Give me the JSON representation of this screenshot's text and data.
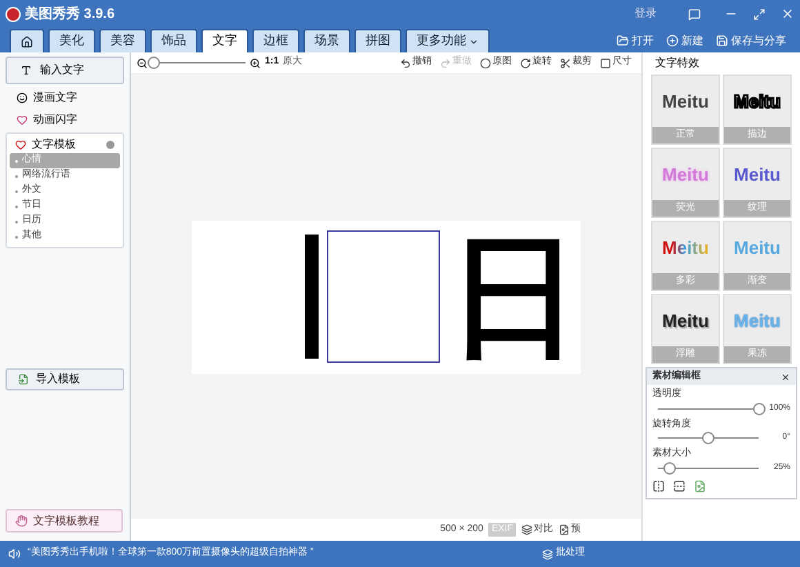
{
  "window": {
    "title": "美图秀秀 3.9.6",
    "login": "登录"
  },
  "tabs": [
    {
      "kind": "home",
      "selected": false
    },
    {
      "kind": "text",
      "label": "美化",
      "selected": false
    },
    {
      "kind": "text",
      "label": "美容",
      "selected": false
    },
    {
      "kind": "text",
      "label": "饰品",
      "selected": false
    },
    {
      "kind": "text",
      "label": "文字",
      "selected": true
    },
    {
      "kind": "text",
      "label": "边框",
      "selected": false
    },
    {
      "kind": "text",
      "label": "场景",
      "selected": false
    },
    {
      "kind": "text",
      "label": "拼图",
      "selected": false
    },
    {
      "kind": "menu",
      "label": "更多功能",
      "selected": false
    }
  ],
  "file_actions": [
    {
      "kind": "open",
      "label": "打开"
    },
    {
      "kind": "new",
      "label": "新建"
    },
    {
      "kind": "save",
      "label": "保存与分享"
    }
  ],
  "toolbar": {
    "zoom": {
      "level": 0.02
    },
    "ratio": "1:1",
    "original_size": "原大",
    "actions": [
      {
        "kind": "undo",
        "label": "撤销",
        "disabled": false
      },
      {
        "kind": "redo",
        "label": "重做",
        "disabled": true
      },
      {
        "kind": "original",
        "label": "原图",
        "disabled": false
      },
      {
        "kind": "rotate",
        "label": "旋转",
        "disabled": false
      },
      {
        "kind": "crop",
        "label": "裁剪",
        "disabled": false
      },
      {
        "kind": "size",
        "label": "尺寸",
        "disabled": false
      }
    ]
  },
  "left_panel": {
    "input_button": "输入文字",
    "items": [
      {
        "kind": "comic",
        "label": "漫画文字"
      },
      {
        "kind": "flash",
        "label": "动画闪字"
      }
    ],
    "template_group": {
      "label": "文字模板",
      "expanded": true,
      "children": [
        {
          "label": "心情",
          "selected": true
        },
        {
          "label": "网络流行语",
          "selected": false
        },
        {
          "label": "外文",
          "selected": false
        },
        {
          "label": "节日",
          "selected": false
        },
        {
          "label": "日历",
          "selected": false
        },
        {
          "label": "其他",
          "selected": false
        }
      ]
    },
    "import_button": "导入模板",
    "tutorial_button": "文字模板教程"
  },
  "canvas": {
    "glyph": "日",
    "image_size": "500 × 200",
    "exif": "EXIF",
    "compare": "对比",
    "preview": "预"
  },
  "effects": {
    "title": "文字特效",
    "items": [
      {
        "kind": "normal",
        "sample": "Meitu",
        "label": "正常"
      },
      {
        "kind": "outline",
        "sample": "Meitu",
        "label": "描边"
      },
      {
        "kind": "glow",
        "sample": "Meitu",
        "label": "荧光"
      },
      {
        "kind": "texture",
        "sample": "Meitu",
        "label": "纹理"
      },
      {
        "kind": "multicolor",
        "sample": "Meitu",
        "label": "多彩"
      },
      {
        "kind": "gradient",
        "sample": "Meitu",
        "label": "渐变"
      },
      {
        "kind": "emboss",
        "sample": "Meitu",
        "label": "浮雕"
      },
      {
        "kind": "frost",
        "sample": "Meitu",
        "label": "果冻"
      }
    ]
  },
  "material_editor": {
    "title": "素材编辑框",
    "sliders": [
      {
        "label": "透明度",
        "level": 1,
        "reading": "100%"
      },
      {
        "label": "旋转角度",
        "level": 0.5,
        "reading": "0°"
      },
      {
        "label": "素材大小",
        "level": 0.12,
        "reading": "25%"
      }
    ]
  },
  "status_bar": {
    "message": "“美图秀秀出手机啦！全球第一款800万前置摄像头的超级自拍神器 ”",
    "batch": "批处理"
  }
}
